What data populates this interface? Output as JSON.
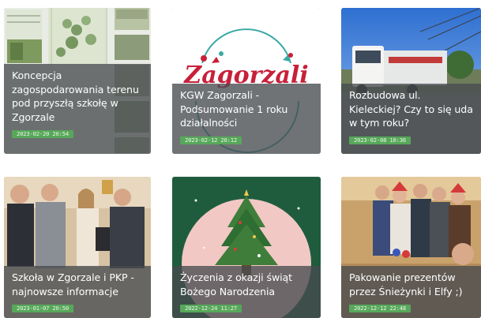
{
  "articles": [
    {
      "title": "Koncepcja zagospodarowania terenu pod przyszłą szkołę w Zgorzale",
      "date": "2023-02-20 20:54",
      "thumbnail_icon": "site-plan-image"
    },
    {
      "title": "KGW Zagorzali - Podsumowanie 1 roku działalności",
      "date": "2023-02-12 20:12",
      "thumbnail_icon": "zagorzali-logo-image",
      "logo_text": "Zagorzali"
    },
    {
      "title": "Rozbudowa ul. Kieleckiej? Czy to się uda w tym roku?",
      "date": "2023-02-08 10:36",
      "thumbnail_icon": "truck-road-image"
    },
    {
      "title": "Szkoła w Zgorzale i PKP - najnowsze informacje",
      "date": "2023-01-07 20:50",
      "thumbnail_icon": "meeting-people-image"
    },
    {
      "title": "Życzenia z okazji świąt Bożego Narodzenia",
      "date": "2022-12-24 11:27",
      "thumbnail_icon": "christmas-tree-image"
    },
    {
      "title": "Pakowanie prezentów przez Śnieżynki i Elfy ;)",
      "date": "2022-12-12 22:48",
      "thumbnail_icon": "volunteers-group-image"
    }
  ],
  "colors": {
    "overlay": "#484c50",
    "date_badge": "#57a85a",
    "logo_red": "#c8203a",
    "logo_teal": "#3aa9a5",
    "christmas_green": "#1f5c3e",
    "christmas_pink": "#f2c8c4"
  }
}
